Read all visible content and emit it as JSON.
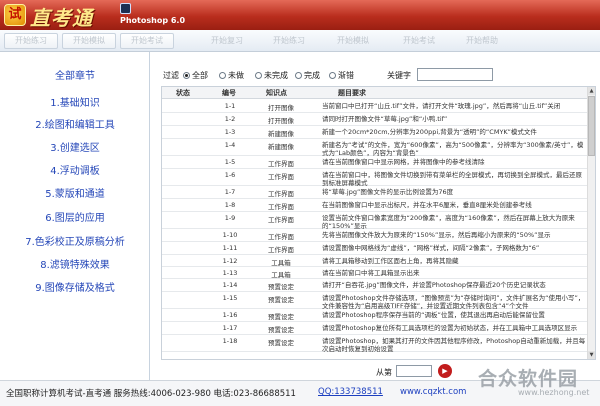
{
  "header": {
    "logo_glyph": "试",
    "app_name": "直考通",
    "product": "Photoshop 6.0"
  },
  "toolbar": {
    "buttons": [
      "开始练习",
      "开始模拟",
      "开始考试",
      "开始复习",
      "开始练习",
      "开始模拟",
      "开始考试",
      "开始帮助"
    ]
  },
  "nav": {
    "title": "全部章节",
    "items": [
      "1.基础知识",
      "2.绘图和编辑工具",
      "3.创建选区",
      "4.浮动调板",
      "5.蒙版和通道",
      "6.图层的应用",
      "7.色彩校正及原稿分析",
      "8.滤镜特殊效果",
      "9.图像存储及格式"
    ]
  },
  "filter": {
    "label": "过滤",
    "options": [
      "全部",
      "未做",
      "未完成",
      "完成",
      "渐错"
    ],
    "selected": 0,
    "keyword_label": "关键字",
    "keyword_value": ""
  },
  "table": {
    "headers": {
      "status": "状态",
      "num": "编号",
      "point": "知识点",
      "req": "题目要求"
    },
    "rows": [
      {
        "num": "1-1",
        "point": "打开图像",
        "req": "当前窗口中已打开“山丘.tif”文件，请打开文件“玫瑰.jpg”，然后再将“山丘.tif”关闭"
      },
      {
        "num": "1-2",
        "point": "打开图像",
        "req": "请同时打开图像文件“草莓.jpg”和“小鸭.tif”"
      },
      {
        "num": "1-3",
        "point": "新建图像",
        "req": "新建一个20cm*20cm,分辨率为200ppi,背景为“透明”的“CMYK”模式文件"
      },
      {
        "num": "1-4",
        "point": "新建图像",
        "req": "新建名为“考试”的文件，宽为“600像素”，高为“500像素”，分辨率为“300像素/英寸”，模式为“Lab颜色”，内容为“背景色”"
      },
      {
        "num": "1-5",
        "point": "工作界面",
        "req": "请在当前图像窗口中显示网格，并将图像中的参考线清除"
      },
      {
        "num": "1-6",
        "point": "工作界面",
        "req": "请在当前窗口中，将图像文件切换到带有菜单栏的全屏模式，再切换到全屏模式，最后还原到标准屏幕模式"
      },
      {
        "num": "1-7",
        "point": "工作界面",
        "req": "将“草莓.jpg”图像文件的显示比例设置为76度"
      },
      {
        "num": "1-8",
        "point": "工作界面",
        "req": "在当前图像窗口中显示出标尺，并在水平6厘米，垂直8厘米处创建参考线"
      },
      {
        "num": "1-9",
        "point": "工作界面",
        "req": "设置当前文件窗口像素宽度为“200像素”，高度为“160像素”，然后在屏幕上放大为原来的“150%”显示"
      },
      {
        "num": "1-10",
        "point": "工作界面",
        "req": "先将当前图像文件放大为原来的“150%”显示，然后再缩小为原来的“50%”显示"
      },
      {
        "num": "1-11",
        "point": "工作界面",
        "req": "请设置图像中网格线为“虚线”，“网格”样式，间隔“2像素”，子网格数为“6”"
      },
      {
        "num": "1-12",
        "point": "工具箱",
        "req": "请将工具箱移动到工作区面右上角，再将其隐藏"
      },
      {
        "num": "1-13",
        "point": "工具箱",
        "req": "请在当前窗口中将工具箱显示出来"
      },
      {
        "num": "1-14",
        "point": "预置设定",
        "req": "请打开“自吞花.jpg”图像文件，并设置Photoshop保存最近20个历史记录状态"
      },
      {
        "num": "1-15",
        "point": "预置设定",
        "req": "请设置Photoshop文件存储选项，“图像预览”为“存储时询问”，文件扩展名为“使用小写”，文件兼容性为“启用高级TIFF存储”，并设置近期文件列表包含“4”个文件"
      },
      {
        "num": "1-16",
        "point": "预置设定",
        "req": "请设置Photoshop程序保存当前的“调板”位置，使其退出再启动后能保留位置"
      },
      {
        "num": "1-17",
        "point": "预置设定",
        "req": "请设置Photoshop复位所有工具选项栏的设置为初始状态，并在工具箱中工具选项区显示"
      },
      {
        "num": "1-18",
        "point": "预置设定",
        "req": "请设置Photoshop，如果其打开的文件因其他程序修改，Photoshop自动重新加载，并且每次启动时恢复到初始设置"
      }
    ]
  },
  "pager": {
    "label": "从第",
    "go_glyph": "▶"
  },
  "footer": {
    "text": "全国职称计算机考试-直考通 服务热线:4006-023-980 电话:023-86688511",
    "qq": "QQ:133738511",
    "url": "www.cqzkt.com"
  },
  "watermark": {
    "main": "合众软件园",
    "sub": "www.hezhong.net"
  }
}
